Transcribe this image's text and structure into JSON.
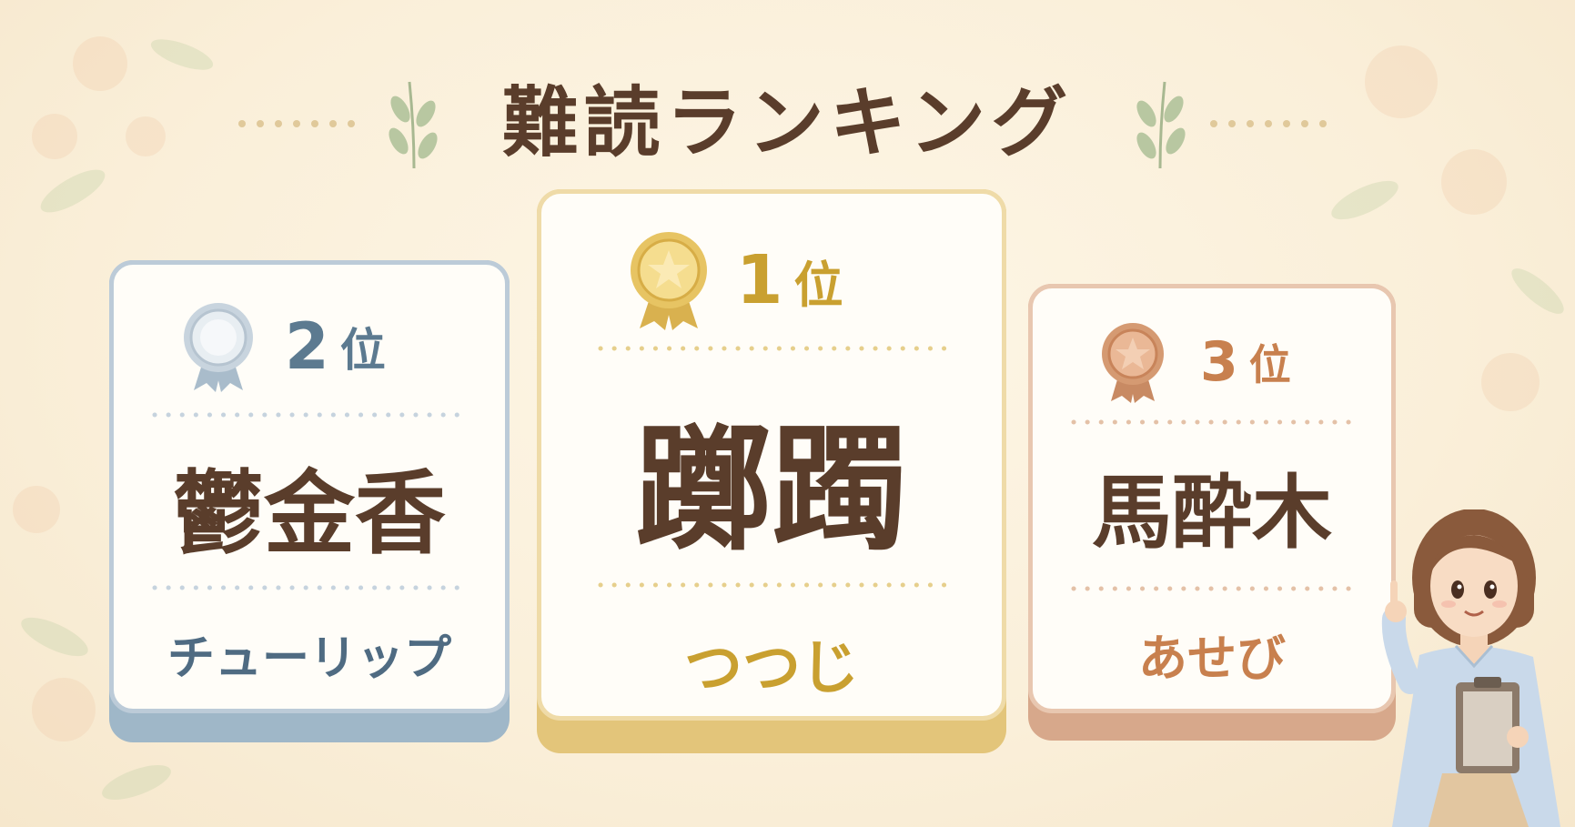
{
  "title": "難読ランキング",
  "colors": {
    "title": "#5a3d2b",
    "silver": "#5c7a90",
    "gold": "#c9a030",
    "bronze": "#c8804e",
    "kanji": "#5a3d2b"
  },
  "cards": [
    {
      "rank_number": "2",
      "rank_suffix": "位",
      "kanji": "鬱金香",
      "reading": "チューリップ",
      "medal": "silver-medal-icon"
    },
    {
      "rank_number": "1",
      "rank_suffix": "位",
      "kanji": "躑躅",
      "reading": "つつじ",
      "medal": "gold-medal-icon"
    },
    {
      "rank_number": "3",
      "rank_suffix": "位",
      "kanji": "馬酔木",
      "reading": "あせび",
      "medal": "bronze-medal-icon"
    }
  ]
}
